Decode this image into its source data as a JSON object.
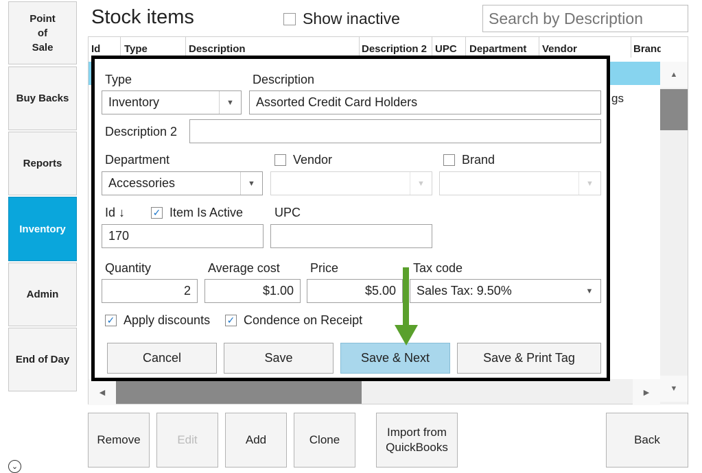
{
  "sidebar": {
    "items": [
      {
        "label": "Point\nof\nSale",
        "active": false
      },
      {
        "label": "Buy Backs",
        "active": false
      },
      {
        "label": "Reports",
        "active": false
      },
      {
        "label": "Inventory",
        "active": true
      },
      {
        "label": "Admin",
        "active": false
      },
      {
        "label": "End of Day",
        "active": false
      }
    ]
  },
  "header": {
    "title": "Stock items",
    "show_inactive_label": "Show inactive",
    "search_placeholder": "Search by Description"
  },
  "table": {
    "columns": [
      "Id",
      "Type",
      "Description",
      "Description 2",
      "UPC",
      "Department",
      "Vendor",
      "Brand"
    ],
    "partial_row_text": "gs"
  },
  "dialog": {
    "type_label": "Type",
    "type_value": "Inventory",
    "description_label": "Description",
    "description_value": "Assorted Credit Card Holders",
    "description2_label": "Description 2",
    "description2_value": "",
    "department_label": "Department",
    "department_value": "Accessories",
    "vendor_label": "Vendor",
    "vendor_checked": false,
    "brand_label": "Brand",
    "brand_checked": false,
    "id_label": "Id ↓",
    "id_value": "170",
    "item_active_label": "Item Is Active",
    "item_active_checked": true,
    "upc_label": "UPC",
    "upc_value": "",
    "quantity_label": "Quantity",
    "quantity_value": "2",
    "avg_cost_label": "Average cost",
    "avg_cost_value": "$1.00",
    "price_label": "Price",
    "price_value": "$5.00",
    "tax_code_label": "Tax code",
    "tax_code_value": "Sales Tax: 9.50%",
    "apply_discounts_label": "Apply discounts",
    "apply_discounts_checked": true,
    "condense_label": "Condence on Receipt",
    "condense_checked": true,
    "buttons": {
      "cancel": "Cancel",
      "save": "Save",
      "save_next": "Save & Next",
      "save_print": "Save & Print Tag"
    }
  },
  "bottom_buttons": {
    "remove": "Remove",
    "edit": "Edit",
    "add": "Add",
    "clone": "Clone",
    "import": "Import from\nQuickBooks",
    "back": "Back"
  },
  "colors": {
    "active_nav": "#0aa6dc",
    "selected_row": "#87d4ef",
    "primary_button": "#a9d7ec",
    "annotation_arrow": "#5aa02c"
  },
  "icons": {
    "dropdown": "chevron-down-icon",
    "checkmark": "check-icon",
    "scroll_up": "triangle-up-icon",
    "scroll_down": "triangle-down-icon",
    "scroll_left": "triangle-left-icon",
    "scroll_right": "triangle-right-icon",
    "annotation": "arrow-down-icon"
  }
}
